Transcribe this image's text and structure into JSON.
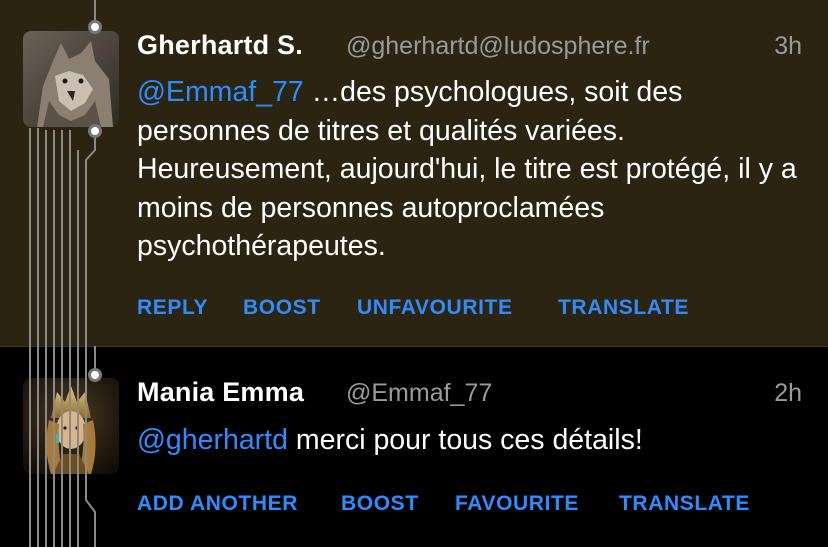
{
  "posts": [
    {
      "author": "Gherhartd S.",
      "handle": "@gherhartd@ludosphere.fr",
      "time": "3h",
      "mention": "@Emmaf_77",
      "text": " …des psychologues, soit des personnes de titres et qualités variées. Heureusement, aujourd'hui, le titre est protégé, il y a moins de personnes autoproclamées psychothérapeutes.",
      "actions": [
        "REPLY",
        "BOOST",
        "UNFAVOURITE",
        "TRANSLATE"
      ]
    },
    {
      "author": "Mania Emma",
      "handle": "@Emmaf_77",
      "time": "2h",
      "mention": "@gherhartd",
      "text": " merci pour tous ces détails!",
      "actions": [
        "ADD ANOTHER",
        "BOOST",
        "FAVOURITE",
        "TRANSLATE"
      ]
    }
  ],
  "colors": {
    "highlight_background": "#2a2410",
    "link": "#2f8cff",
    "muted": "#9a9a9a"
  }
}
